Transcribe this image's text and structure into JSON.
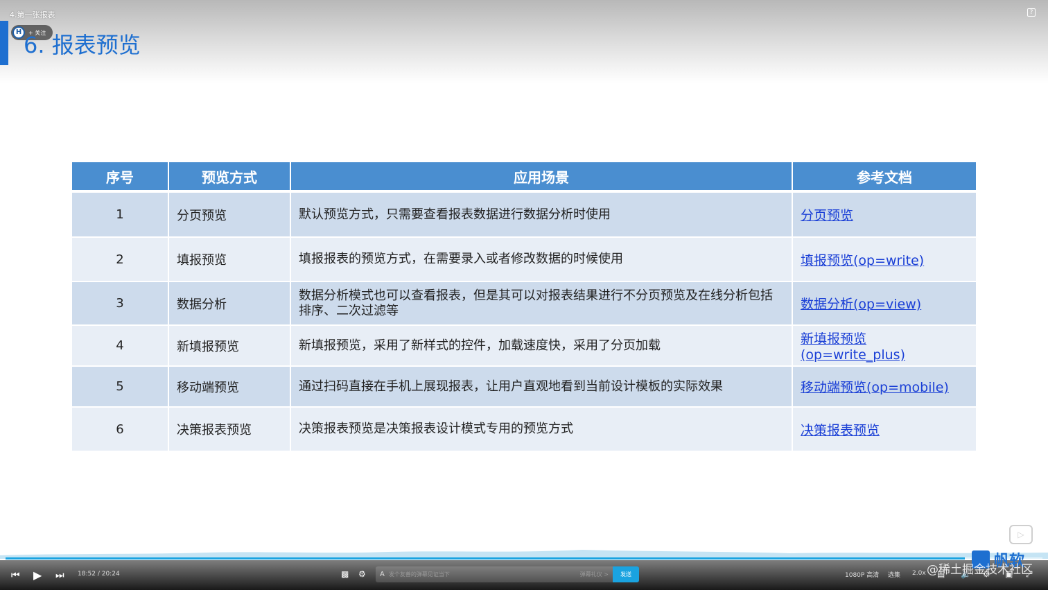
{
  "video": {
    "title": "4.第一张报表",
    "help_icon": "?"
  },
  "follow": {
    "avatar_glyph": "H",
    "label": "+ 关注"
  },
  "slide": {
    "title": "6. 报表预览",
    "table": {
      "headers": [
        "序号",
        "预览方式",
        "应用场景",
        "参考文档"
      ],
      "rows": [
        {
          "num": "1",
          "mode": "分页预览",
          "scene": "默认预览方式，只需要查看报表数据进行数据分析时使用",
          "doc": "分页预览"
        },
        {
          "num": "2",
          "mode": "填报预览",
          "scene": "填报报表的预览方式，在需要录入或者修改数据的时候使用",
          "doc": "填报预览(op=write)"
        },
        {
          "num": "3",
          "mode": "数据分析",
          "scene": "数据分析模式也可以查看报表，但是其可以对报表结果进行不分页预览及在线分析包括排序、二次过滤等",
          "doc": "数据分析(op=view)"
        },
        {
          "num": "4",
          "mode": "新填报预览",
          "scene": "新填报预览，采用了新样式的控件，加载速度快，采用了分页加载",
          "doc": "新填报预览(op=write_plus)"
        },
        {
          "num": "5",
          "mode": "移动端预览",
          "scene": "通过扫码直接在手机上展现报表，让用户直观地看到当前设计模板的实际效果",
          "doc": "移动端预览(op=mobile)"
        },
        {
          "num": "6",
          "mode": "决策报表预览",
          "scene": "决策报表预览是决策报表设计模式专用的预览方式",
          "doc": "决策报表预览"
        }
      ]
    },
    "logo_text": "帆软",
    "watermark": "@稀土掘金技术社区"
  },
  "player": {
    "current_time": "18:52",
    "separator": "/",
    "duration": "20:24",
    "progress_fraction": 0.925,
    "danmaku_placeholder": "发个友善的弹幕见证当下",
    "danmaku_etiquette": "弹幕礼仪 >",
    "send_label": "发送",
    "quality": "1080P 高清",
    "episodes": "选集",
    "speed": "2.0x",
    "accent_color": "#1aa3e0"
  }
}
